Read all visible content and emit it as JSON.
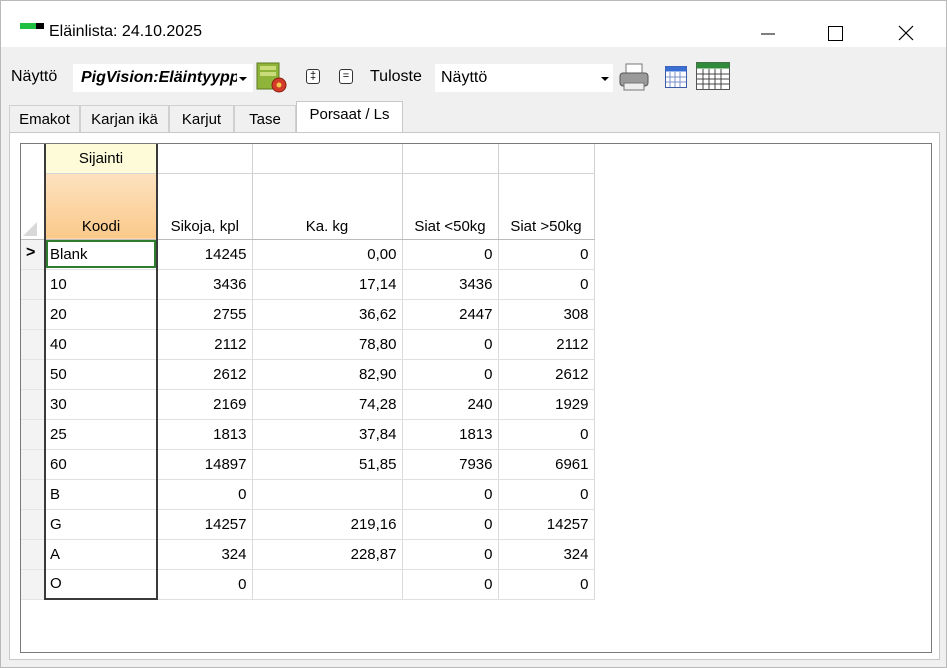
{
  "window": {
    "title": "Eläinlista: 24.10.2025",
    "minimize_icon": "minimize-icon",
    "maximize_icon": "maximize-icon",
    "close_icon": "close-icon"
  },
  "toolbar": {
    "view_label": "Näyttö",
    "view_value": "PigVision:Eläintyyppi",
    "expand_btn": "‡",
    "equal_btn": "=",
    "output_label": "Tuloste",
    "output_value": "Näyttö",
    "icons": [
      "settings-gear-icon",
      "print-icon",
      "calendar-small-icon",
      "calendar-icon"
    ]
  },
  "tabs": [
    "Emakot",
    "Karjan ikä",
    "Karjut",
    "Tase",
    "Porsaat / Ls"
  ],
  "active_tab": "Porsaat / Ls",
  "grid": {
    "band_header": "Sijainti",
    "columns": [
      "Koodi",
      "Sikoja, kpl",
      "Ka. kg",
      "Siat <50kg",
      "Siat >50kg"
    ],
    "current_row_marker": ">",
    "rows": [
      [
        "Blank",
        "14245",
        "0,00",
        "0",
        "0"
      ],
      [
        "10",
        "3436",
        "17,14",
        "3436",
        "0"
      ],
      [
        "20",
        "2755",
        "36,62",
        "2447",
        "308"
      ],
      [
        "40",
        "2112",
        "78,80",
        "0",
        "2112"
      ],
      [
        "50",
        "2612",
        "82,90",
        "0",
        "2612"
      ],
      [
        "30",
        "2169",
        "74,28",
        "240",
        "1929"
      ],
      [
        "25",
        "1813",
        "37,84",
        "1813",
        "0"
      ],
      [
        "60",
        "14897",
        "51,85",
        "7936",
        "6961"
      ],
      [
        "B",
        "0",
        "",
        "0",
        "0"
      ],
      [
        "G",
        "14257",
        "219,16",
        "0",
        "14257"
      ],
      [
        "A",
        "324",
        "228,87",
        "0",
        "324"
      ],
      [
        "O",
        "0",
        "",
        "0",
        "0"
      ]
    ]
  },
  "colors": {
    "band": "#fdfbd8",
    "key_header": "#fac98a",
    "selection": "#2e7d2e",
    "app_icon": "#1fbf3f"
  }
}
